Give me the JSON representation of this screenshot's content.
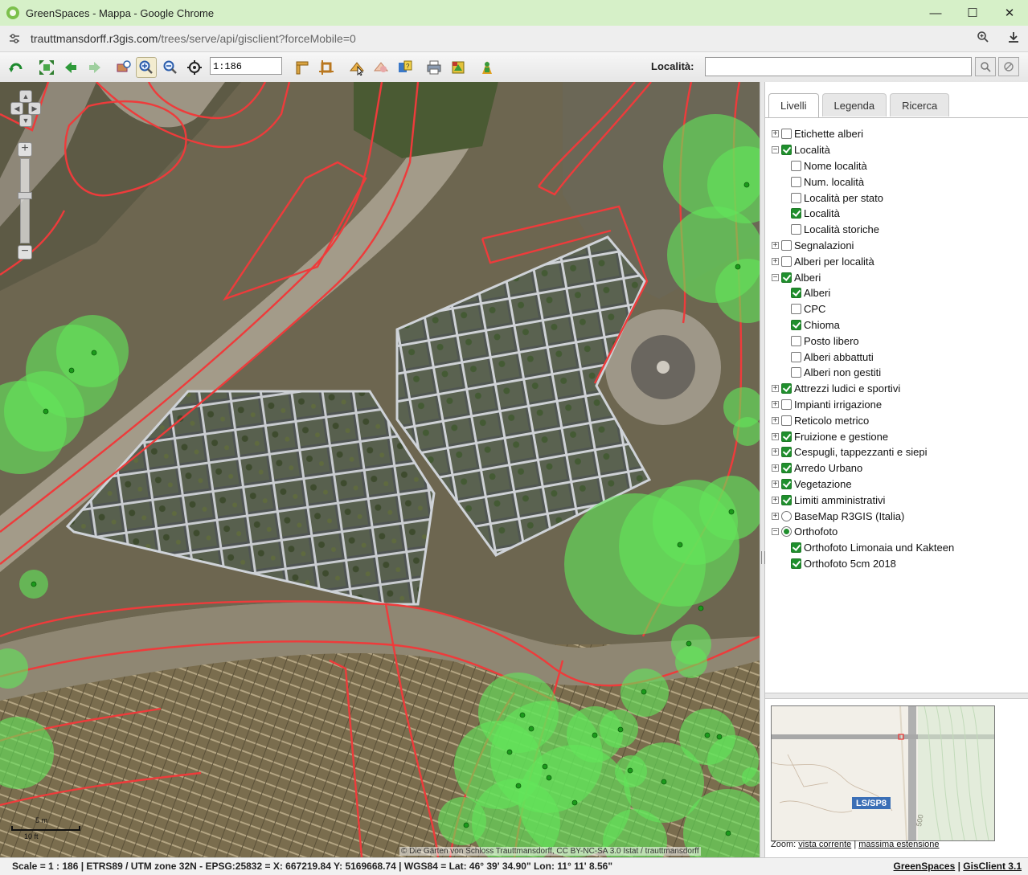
{
  "window": {
    "title": "GreenSpaces - Mappa - Google Chrome",
    "minimize": "—",
    "maximize": "☐",
    "close": "✕"
  },
  "address": {
    "url_host": "trauttmansdorff.r3gis.com",
    "url_path": "/trees/serve/api/gisclient?forceMobile=0"
  },
  "toolbar": {
    "scale_value": "1:186",
    "locality_label": "Località:",
    "locality_value": "",
    "icons": [
      "refresh-icon",
      "full-extent-icon",
      "back-icon",
      "forward-icon",
      "zoom-box-icon",
      "zoom-in-icon",
      "zoom-out-icon",
      "center-icon",
      "measure-line-icon",
      "measure-area-icon",
      "select-icon",
      "info-icon",
      "query-icon",
      "print-icon",
      "export-icon",
      "user-icon"
    ]
  },
  "panel": {
    "tabs": [
      {
        "label": "Livelli",
        "active": true
      },
      {
        "label": "Legenda",
        "active": false
      },
      {
        "label": "Ricerca",
        "active": false
      }
    ],
    "layers": [
      {
        "label": "Etichette alberi",
        "level": 0,
        "expander": "+",
        "checked": false,
        "type": "checkbox"
      },
      {
        "label": "Località",
        "level": 0,
        "expander": "−",
        "checked": true,
        "type": "checkbox"
      },
      {
        "label": "Nome località",
        "level": 1,
        "checked": false,
        "type": "checkbox"
      },
      {
        "label": "Num. località",
        "level": 1,
        "checked": false,
        "type": "checkbox"
      },
      {
        "label": "Località per stato",
        "level": 1,
        "checked": false,
        "type": "checkbox"
      },
      {
        "label": "Località",
        "level": 1,
        "checked": true,
        "type": "checkbox"
      },
      {
        "label": "Località storiche",
        "level": 1,
        "checked": false,
        "type": "checkbox"
      },
      {
        "label": "Segnalazioni",
        "level": 0,
        "expander": "+",
        "checked": false,
        "type": "checkbox"
      },
      {
        "label": "Alberi per località",
        "level": 0,
        "expander": "+",
        "checked": false,
        "type": "checkbox"
      },
      {
        "label": "Alberi",
        "level": 0,
        "expander": "−",
        "checked": true,
        "type": "checkbox"
      },
      {
        "label": "Alberi",
        "level": 1,
        "checked": true,
        "type": "checkbox"
      },
      {
        "label": "CPC",
        "level": 1,
        "checked": false,
        "type": "checkbox"
      },
      {
        "label": "Chioma",
        "level": 1,
        "checked": true,
        "type": "checkbox"
      },
      {
        "label": "Posto libero",
        "level": 1,
        "checked": false,
        "type": "checkbox"
      },
      {
        "label": "Alberi abbattuti",
        "level": 1,
        "checked": false,
        "type": "checkbox"
      },
      {
        "label": "Alberi non gestiti",
        "level": 1,
        "checked": false,
        "type": "checkbox"
      },
      {
        "label": "Attrezzi ludici e sportivi",
        "level": 0,
        "expander": "+",
        "checked": true,
        "type": "checkbox"
      },
      {
        "label": "Impianti irrigazione",
        "level": 0,
        "expander": "+",
        "checked": false,
        "type": "checkbox"
      },
      {
        "label": "Reticolo metrico",
        "level": 0,
        "expander": "+",
        "checked": false,
        "type": "checkbox"
      },
      {
        "label": "Fruizione e gestione",
        "level": 0,
        "expander": "+",
        "checked": true,
        "type": "checkbox"
      },
      {
        "label": "Cespugli, tappezzanti e siepi",
        "level": 0,
        "expander": "+",
        "checked": true,
        "type": "checkbox"
      },
      {
        "label": "Arredo Urbano",
        "level": 0,
        "expander": "+",
        "checked": true,
        "type": "checkbox"
      },
      {
        "label": "Vegetazione",
        "level": 0,
        "expander": "+",
        "checked": true,
        "type": "checkbox"
      },
      {
        "label": "Limiti amministrativi",
        "level": 0,
        "expander": "+",
        "checked": true,
        "type": "checkbox"
      },
      {
        "label": "BaseMap R3GIS (Italia)",
        "level": 0,
        "expander": "+",
        "checked": false,
        "type": "radio"
      },
      {
        "label": "Orthofoto",
        "level": 0,
        "expander": "−",
        "checked": true,
        "type": "radio"
      },
      {
        "label": "Orthofoto Limonaia und Kakteen",
        "level": 1,
        "checked": true,
        "type": "checkbox"
      },
      {
        "label": "Orthofoto 5cm 2018",
        "level": 1,
        "checked": true,
        "type": "checkbox"
      }
    ]
  },
  "map": {
    "attribution": "© Die Gärten von Schloss Trauttmansdorff, CC BY-NC-SA 3.0 Istat / trauttmansdorff",
    "scalebar_top": "5 m",
    "scalebar_bottom": "10 ft",
    "zoom_in": "+",
    "zoom_out": "−"
  },
  "overview": {
    "road_label": "LS/SP8",
    "contour_label": "500",
    "zoom_label": "Zoom:",
    "current_view_link": "vista corrente",
    "separator": "|",
    "max_extent_link": "massima estensione"
  },
  "status": {
    "text": "Scale = 1 : 186  | ETRS89 / UTM zone 32N - EPSG:25832 = X: 667219.84 Y: 5169668.74  | WGS84 = Lat: 46° 39' 34.90\" Lon: 11° 11' 8.56\"",
    "link1": "GreenSpaces",
    "sep": "|",
    "link2": "GisClient 3.1"
  },
  "colors": {
    "titlebar": "#d6f0c8",
    "parcel_outline": "#e83a3a",
    "tree_canopy": "#62e55a",
    "tree_point": "#1a8f1a",
    "check_green": "#1f8f2d"
  }
}
